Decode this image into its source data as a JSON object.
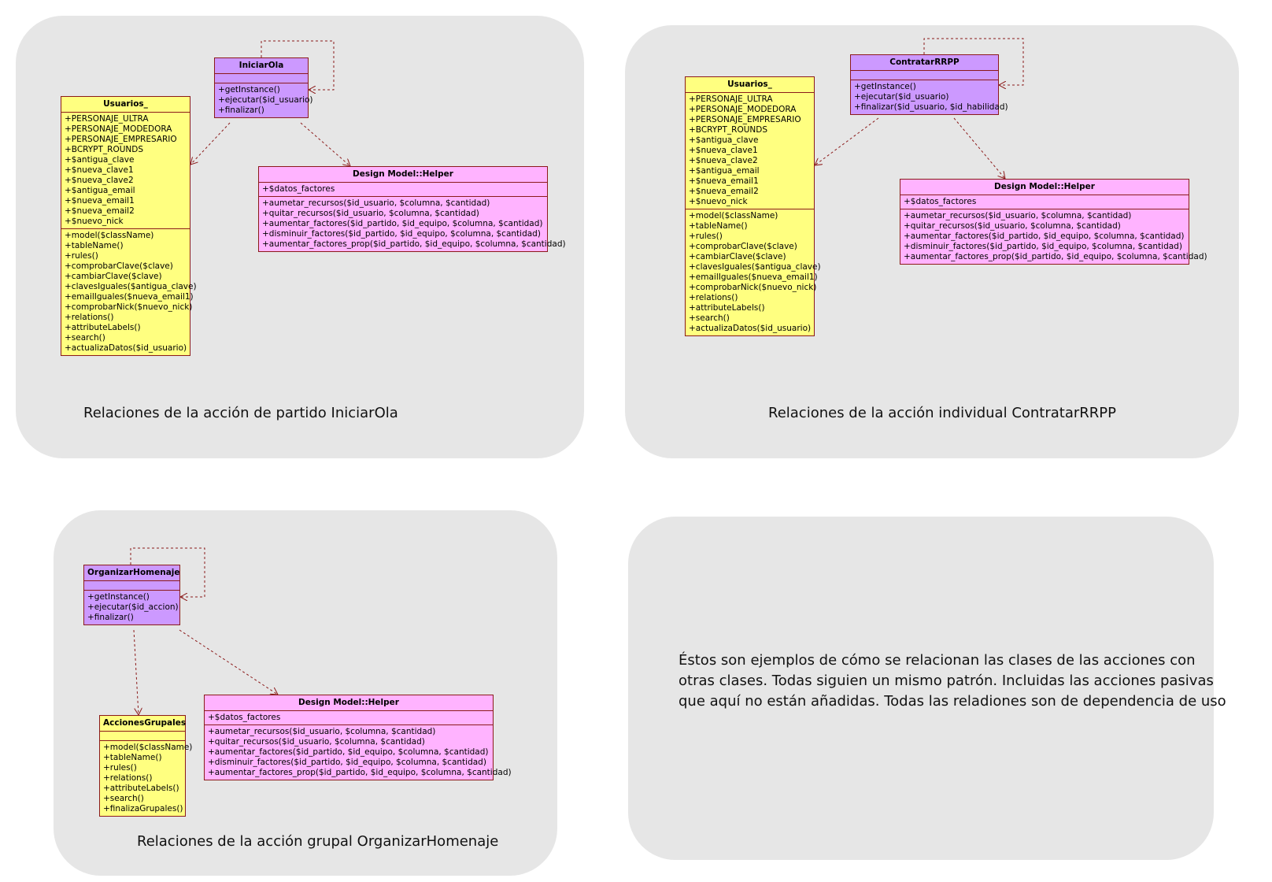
{
  "panels": {
    "p1": {
      "caption": "Relaciones de la acción de partido IniciarOla",
      "action": {
        "name": "IniciarOla",
        "attributes": [],
        "methods": [
          "+getInstance()",
          "+ejecutar($id_usuario)",
          "+finalizar()"
        ]
      },
      "model": {
        "name": "Usuarios_",
        "attributes": [
          "+PERSONAJE_ULTRA",
          "+PERSONAJE_MODEDORA",
          "+PERSONAJE_EMPRESARIO",
          "+BCRYPT_ROUNDS",
          "+$antigua_clave",
          "+$nueva_clave1",
          "+$nueva_clave2",
          "+$antigua_email",
          "+$nueva_email1",
          "+$nueva_email2",
          "+$nuevo_nick"
        ],
        "methods": [
          "+model($className)",
          "+tableName()",
          "+rules()",
          "+comprobarClave($clave)",
          "+cambiarClave($clave)",
          "+clavesIguales($antigua_clave)",
          "+emailIguales($nueva_email1)",
          "+comprobarNick($nuevo_nick)",
          "+relations()",
          "+attributeLabels()",
          "+search()",
          "+actualizaDatos($id_usuario)"
        ]
      },
      "helper": {
        "name": "Design Model::Helper",
        "attributes": [
          "+$datos_factores"
        ],
        "methods": [
          "+aumetar_recursos($id_usuario, $columna, $cantidad)",
          "+quitar_recursos($id_usuario, $columna, $cantidad)",
          "+aumentar_factores($id_partido, $id_equipo, $columna, $cantidad)",
          "+disminuir_factores($id_partido, $id_equipo, $columna, $cantidad)",
          "+aumentar_factores_prop($id_partido, $id_equipo, $columna, $cantidad)"
        ]
      }
    },
    "p2": {
      "caption": "Relaciones de la acción individual ContratarRRPP",
      "action": {
        "name": "ContratarRRPP",
        "attributes": [],
        "methods": [
          "+getInstance()",
          "+ejecutar($id_usuario)",
          "+finalizar($id_usuario, $id_habilidad)"
        ]
      },
      "model": {
        "name": "Usuarios_",
        "attributes": [
          "+PERSONAJE_ULTRA",
          "+PERSONAJE_MODEDORA",
          "+PERSONAJE_EMPRESARIO",
          "+BCRYPT_ROUNDS",
          "+$antigua_clave",
          "+$nueva_clave1",
          "+$nueva_clave2",
          "+$antigua_email",
          "+$nueva_email1",
          "+$nueva_email2",
          "+$nuevo_nick"
        ],
        "methods": [
          "+model($className)",
          "+tableName()",
          "+rules()",
          "+comprobarClave($clave)",
          "+cambiarClave($clave)",
          "+clavesIguales($antigua_clave)",
          "+emailIguales($nueva_email1)",
          "+comprobarNick($nuevo_nick)",
          "+relations()",
          "+attributeLabels()",
          "+search()",
          "+actualizaDatos($id_usuario)"
        ]
      },
      "helper": {
        "name": "Design Model::Helper",
        "attributes": [
          "+$datos_factores"
        ],
        "methods": [
          "+aumetar_recursos($id_usuario, $columna, $cantidad)",
          "+quitar_recursos($id_usuario, $columna, $cantidad)",
          "+aumentar_factores($id_partido, $id_equipo, $columna, $cantidad)",
          "+disminuir_factores($id_partido, $id_equipo, $columna, $cantidad)",
          "+aumentar_factores_prop($id_partido, $id_equipo, $columna, $cantidad)"
        ]
      }
    },
    "p3": {
      "caption": "Relaciones de la acción grupal OrganizarHomenaje",
      "action": {
        "name": "OrganizarHomenaje",
        "attributes": [],
        "methods": [
          "+getInstance()",
          "+ejecutar($id_accion)",
          "+finalizar()"
        ]
      },
      "model": {
        "name": "AccionesGrupales",
        "attributes": [],
        "methods": [
          "+model($className)",
          "+tableName()",
          "+rules()",
          "+relations()",
          "+attributeLabels()",
          "+search()",
          "+finalizaGrupales()"
        ]
      },
      "helper": {
        "name": "Design Model::Helper",
        "attributes": [
          "+$datos_factores"
        ],
        "methods": [
          "+aumetar_recursos($id_usuario, $columna, $cantidad)",
          "+quitar_recursos($id_usuario, $columna, $cantidad)",
          "+aumentar_factores($id_partido, $id_equipo, $columna, $cantidad)",
          "+disminuir_factores($id_partido, $id_equipo, $columna, $cantidad)",
          "+aumentar_factores_prop($id_partido, $id_equipo, $columna, $cantidad)"
        ]
      }
    },
    "p4": {
      "note_lines": [
        "Éstos son ejemplos de cómo se relacionan las clases de las acciones con",
        "otras clases. Todas siguien un mismo patrón. Incluidas las acciones pasivas",
        "que aquí no están añadidas. Todas las reladiones son de dependencia de uso"
      ]
    }
  },
  "colors": {
    "panel": "#e6e6e6",
    "action_class": "#cc99ff",
    "model_class": "#ffff80",
    "helper_class": "#ffb3ff",
    "border": "#8b1a1a"
  }
}
